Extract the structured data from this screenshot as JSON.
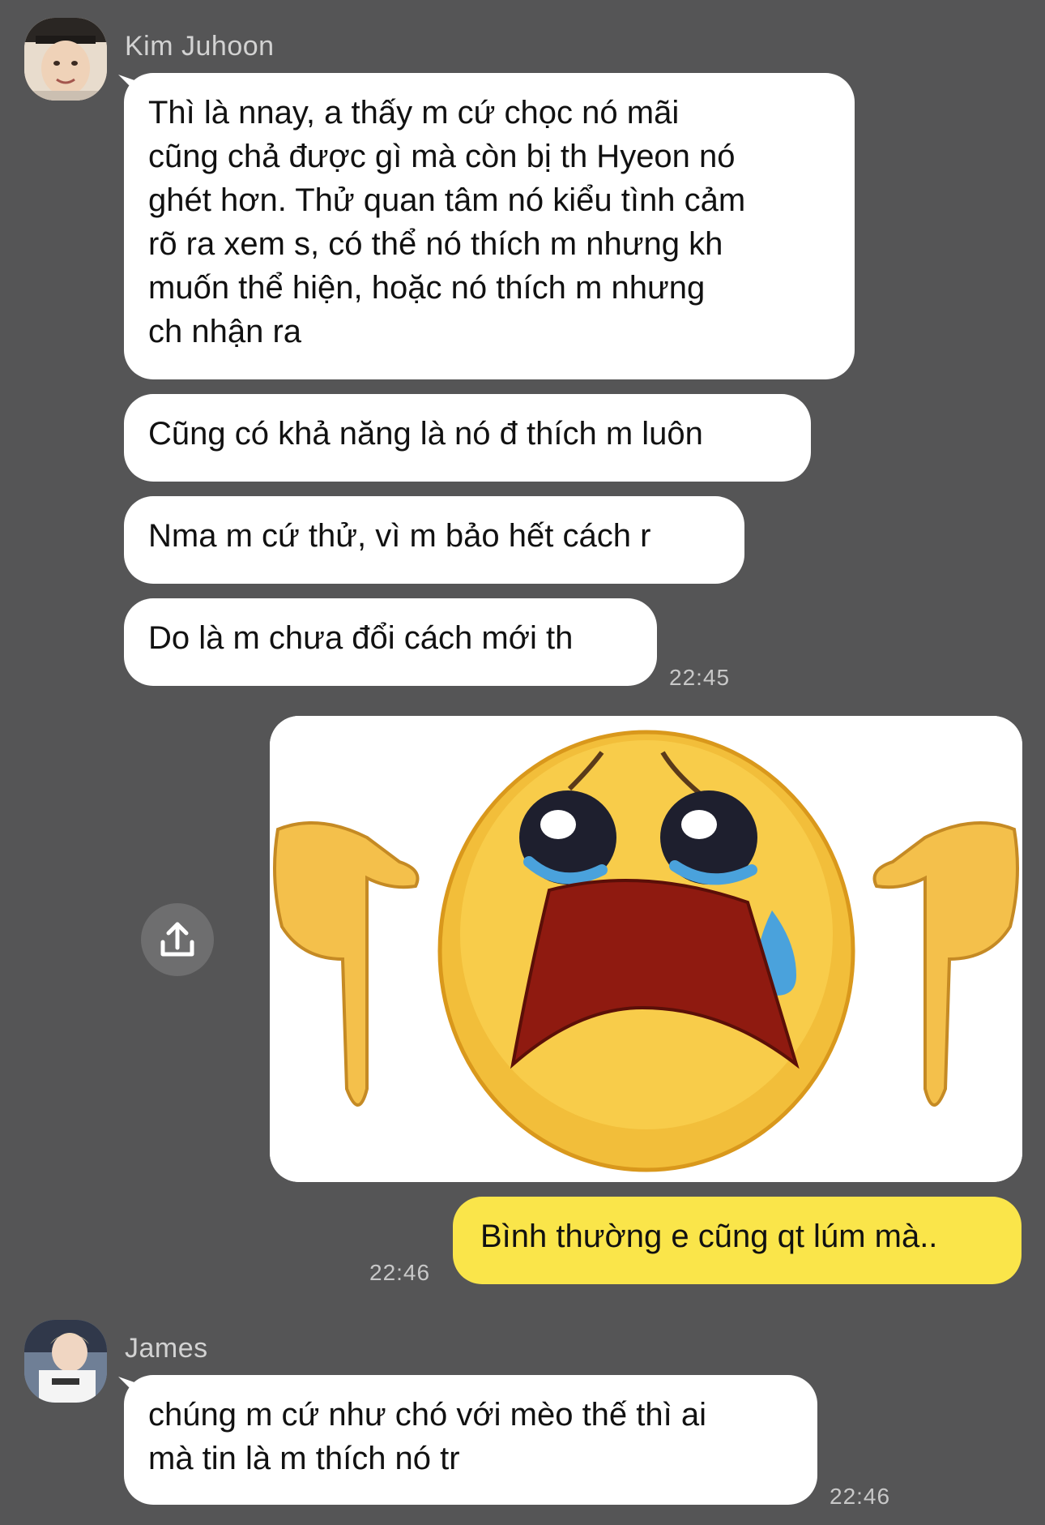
{
  "chat": {
    "kim": {
      "name": "Kim Juhoon",
      "messages": [
        "Thì là nnay, a thấy m cứ chọc nó mãi\ncũng chả được gì mà còn bị th Hyeon nó\nghét hơn. Thử quan tâm nó kiểu tình cảm\nrõ ra xem s, có thể nó thích m nhưng kh\nmuốn thể hiện, hoặc nó thích m nhưng\nch nhận ra",
        "Cũng có khả năng là nó đ thích m luôn",
        "Nma m cứ thử, vì m bảo hết cách r",
        "Do là m chưa đổi cách mới th"
      ],
      "time": "22:45"
    },
    "me": {
      "image_alt": "crying-emoji-pointing-down",
      "message": "Bình thường e cũng qt lúm mà..",
      "time": "22:46"
    },
    "james": {
      "name": "James",
      "message": "chúng m cứ như chó với mèo thế thì ai\nmà tin là m thích nó tr",
      "time": "22:46"
    }
  },
  "icons": {
    "share": "share-upload-icon"
  },
  "colors": {
    "background": "#555556",
    "bubble_other": "#ffffff",
    "bubble_mine": "#fae54a",
    "meta_text": "#c8c8c8"
  }
}
